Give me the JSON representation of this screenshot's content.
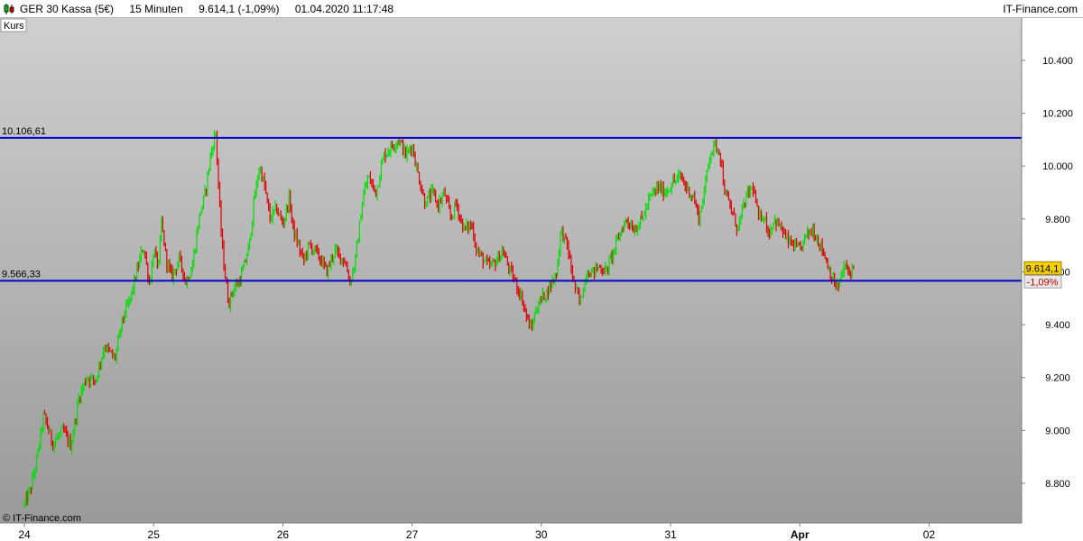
{
  "header": {
    "instrument": "GER 30 Kassa (5€)",
    "interval": "15 Minuten",
    "quote": "9.614,1 (-1,09%)",
    "timestamp": "01.04.2020 11:17:48",
    "brand": "IT-Finance.com",
    "icon": "candlestick-icon"
  },
  "chart_data": {
    "type": "candlestick",
    "panel_label": "Kurs",
    "copyright": "© IT-Finance.com",
    "ylim": [
      8650,
      10560
    ],
    "y_ticks": [
      {
        "value": 8800,
        "label": "8.800"
      },
      {
        "value": 9000,
        "label": "9.000"
      },
      {
        "value": 9200,
        "label": "9.200"
      },
      {
        "value": 9400,
        "label": "9.400"
      },
      {
        "value": 9600,
        "label": "9.600"
      },
      {
        "value": 9800,
        "label": "9.800"
      },
      {
        "value": 10000,
        "label": "10.000"
      },
      {
        "value": 10200,
        "label": "10.200"
      },
      {
        "value": 10400,
        "label": "10.400"
      }
    ],
    "x_days": [
      {
        "label": "24",
        "day": 0
      },
      {
        "label": "25",
        "day": 1
      },
      {
        "label": "26",
        "day": 2
      },
      {
        "label": "27",
        "day": 3
      },
      {
        "label": "30",
        "day": 4
      },
      {
        "label": "31",
        "day": 5
      },
      {
        "label": "Apr",
        "day": 6
      },
      {
        "label": "02",
        "day": 7
      }
    ],
    "x_range_days": [
      -0.02,
      7.85
    ],
    "horizontal_lines": [
      {
        "value": 10106.61,
        "label": "10.106,61",
        "color": "#0000cc"
      },
      {
        "value": 9566.33,
        "label": "9.566,33",
        "color": "#0000cc"
      }
    ],
    "last_price": {
      "value": 9614.1,
      "label": "9.614,1",
      "change_label": "-1,09%"
    },
    "colors": {
      "up": "#00e000",
      "down": "#e00000",
      "bg_top": "#cfcfcf",
      "bg_bottom": "#9a9a9a"
    },
    "path": [
      [
        0.0,
        8720
      ],
      [
        0.05,
        8780
      ],
      [
        0.1,
        8900
      ],
      [
        0.15,
        9060
      ],
      [
        0.22,
        8950
      ],
      [
        0.3,
        9000
      ],
      [
        0.36,
        8940
      ],
      [
        0.42,
        9120
      ],
      [
        0.48,
        9200
      ],
      [
        0.55,
        9190
      ],
      [
        0.62,
        9320
      ],
      [
        0.7,
        9270
      ],
      [
        0.76,
        9420
      ],
      [
        0.82,
        9500
      ],
      [
        0.88,
        9620
      ],
      [
        0.92,
        9700
      ],
      [
        0.97,
        9550
      ],
      [
        1.0,
        9680
      ],
      [
        1.04,
        9620
      ],
      [
        1.06,
        9790
      ],
      [
        1.1,
        9640
      ],
      [
        1.14,
        9580
      ],
      [
        1.2,
        9650
      ],
      [
        1.25,
        9560
      ],
      [
        1.3,
        9620
      ],
      [
        1.35,
        9800
      ],
      [
        1.4,
        9900
      ],
      [
        1.44,
        10040
      ],
      [
        1.48,
        10130
      ],
      [
        1.52,
        9760
      ],
      [
        1.55,
        9600
      ],
      [
        1.58,
        9480
      ],
      [
        1.62,
        9540
      ],
      [
        1.66,
        9560
      ],
      [
        1.7,
        9620
      ],
      [
        1.74,
        9700
      ],
      [
        1.78,
        9880
      ],
      [
        1.82,
        10000
      ],
      [
        1.86,
        9920
      ],
      [
        1.9,
        9800
      ],
      [
        1.95,
        9840
      ],
      [
        2.0,
        9780
      ],
      [
        2.05,
        9880
      ],
      [
        2.08,
        9760
      ],
      [
        2.12,
        9700
      ],
      [
        2.16,
        9640
      ],
      [
        2.2,
        9700
      ],
      [
        2.25,
        9680
      ],
      [
        2.3,
        9640
      ],
      [
        2.34,
        9600
      ],
      [
        2.4,
        9680
      ],
      [
        2.44,
        9660
      ],
      [
        2.48,
        9640
      ],
      [
        2.52,
        9560
      ],
      [
        2.56,
        9640
      ],
      [
        2.62,
        9880
      ],
      [
        2.66,
        9960
      ],
      [
        2.72,
        9900
      ],
      [
        2.78,
        10040
      ],
      [
        2.85,
        10080
      ],
      [
        2.9,
        10100
      ],
      [
        2.95,
        10040
      ],
      [
        3.0,
        10080
      ],
      [
        3.04,
        9980
      ],
      [
        3.1,
        9860
      ],
      [
        3.16,
        9900
      ],
      [
        3.2,
        9850
      ],
      [
        3.25,
        9900
      ],
      [
        3.3,
        9800
      ],
      [
        3.34,
        9860
      ],
      [
        3.4,
        9760
      ],
      [
        3.46,
        9780
      ],
      [
        3.5,
        9680
      ],
      [
        3.56,
        9640
      ],
      [
        3.6,
        9620
      ],
      [
        3.65,
        9640
      ],
      [
        3.7,
        9680
      ],
      [
        3.76,
        9600
      ],
      [
        3.8,
        9560
      ],
      [
        3.85,
        9500
      ],
      [
        3.88,
        9440
      ],
      [
        3.92,
        9380
      ],
      [
        3.96,
        9460
      ],
      [
        4.0,
        9500
      ],
      [
        4.04,
        9520
      ],
      [
        4.08,
        9560
      ],
      [
        4.12,
        9600
      ],
      [
        4.15,
        9760
      ],
      [
        4.2,
        9700
      ],
      [
        4.25,
        9560
      ],
      [
        4.3,
        9480
      ],
      [
        4.35,
        9600
      ],
      [
        4.4,
        9600
      ],
      [
        4.45,
        9620
      ],
      [
        4.5,
        9600
      ],
      [
        4.56,
        9680
      ],
      [
        4.62,
        9760
      ],
      [
        4.66,
        9800
      ],
      [
        4.72,
        9760
      ],
      [
        4.78,
        9800
      ],
      [
        4.84,
        9880
      ],
      [
        4.9,
        9920
      ],
      [
        4.96,
        9900
      ],
      [
        5.02,
        9940
      ],
      [
        5.08,
        9960
      ],
      [
        5.12,
        9920
      ],
      [
        5.18,
        9880
      ],
      [
        5.22,
        9800
      ],
      [
        5.26,
        9900
      ],
      [
        5.3,
        10040
      ],
      [
        5.34,
        10080
      ],
      [
        5.38,
        10060
      ],
      [
        5.42,
        9900
      ],
      [
        5.48,
        9820
      ],
      [
        5.52,
        9760
      ],
      [
        5.56,
        9840
      ],
      [
        5.6,
        9900
      ],
      [
        5.64,
        9920
      ],
      [
        5.68,
        9800
      ],
      [
        5.72,
        9820
      ],
      [
        5.76,
        9740
      ],
      [
        5.8,
        9800
      ],
      [
        5.86,
        9760
      ],
      [
        5.9,
        9720
      ],
      [
        5.95,
        9700
      ],
      [
        6.0,
        9680
      ],
      [
        6.05,
        9740
      ],
      [
        6.1,
        9760
      ],
      [
        6.14,
        9720
      ],
      [
        6.18,
        9680
      ],
      [
        6.22,
        9620
      ],
      [
        6.26,
        9560
      ],
      [
        6.3,
        9540
      ],
      [
        6.34,
        9620
      ],
      [
        6.38,
        9600
      ],
      [
        6.42,
        9614.1
      ]
    ]
  }
}
